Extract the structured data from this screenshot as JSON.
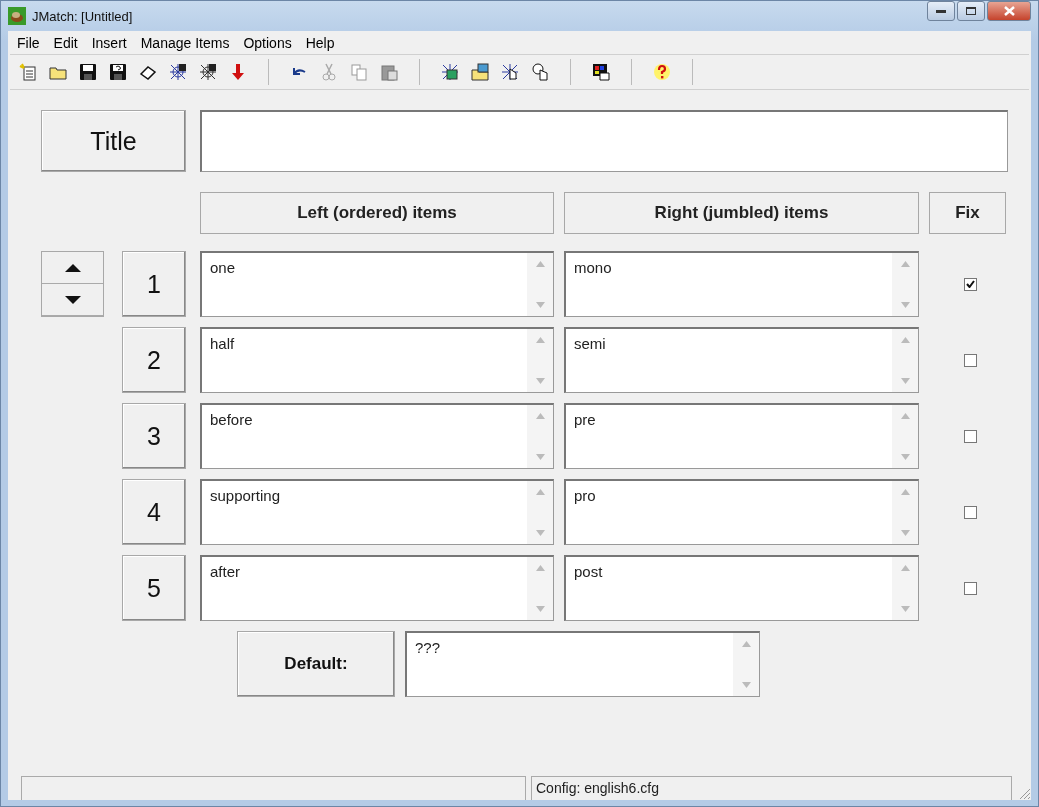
{
  "window": {
    "title": "JMatch: [Untitled]"
  },
  "menu": [
    "File",
    "Edit",
    "Insert",
    "Manage Items",
    "Options",
    "Help"
  ],
  "title_row": {
    "label": "Title"
  },
  "headers": {
    "left": "Left (ordered) items",
    "right": "Right (jumbled) items",
    "fix": "Fix"
  },
  "rows": [
    {
      "number": "1",
      "left": "one",
      "right": "mono",
      "fixed": true
    },
    {
      "number": "2",
      "left": "half",
      "right": "semi",
      "fixed": false
    },
    {
      "number": "3",
      "left": "before",
      "right": "pre",
      "fixed": false
    },
    {
      "number": "4",
      "left": "supporting",
      "right": "pro",
      "fixed": false
    },
    {
      "number": "5",
      "left": "after",
      "right": "post",
      "fixed": false
    }
  ],
  "default": {
    "label": "Default:",
    "value": "???"
  },
  "status_bar": {
    "config": "Config: english6.cfg"
  }
}
